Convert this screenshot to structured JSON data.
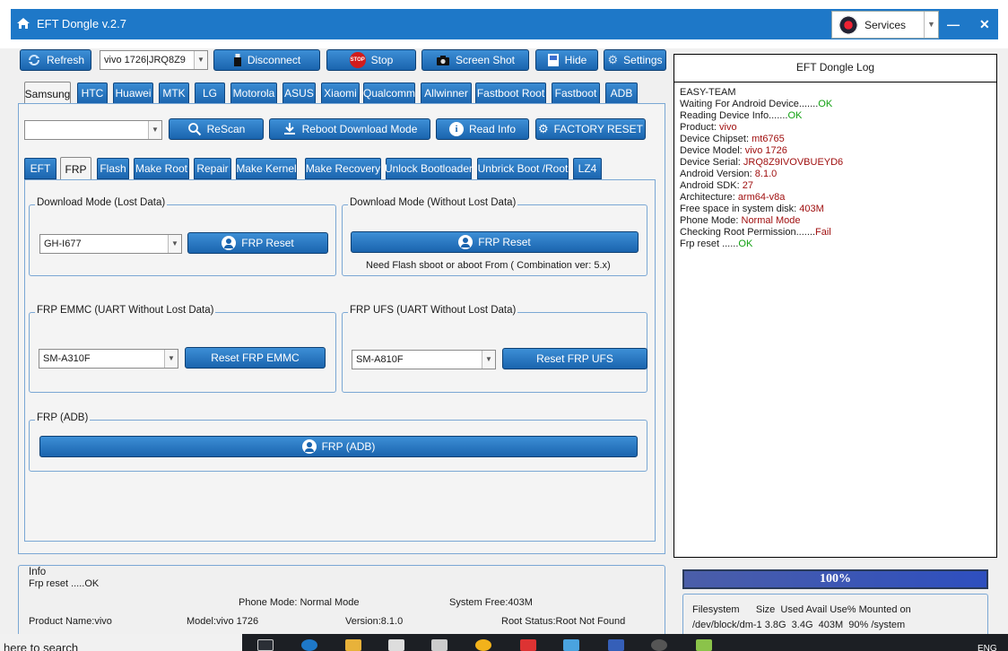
{
  "window": {
    "title": "EFT Dongle  v.2.7",
    "services_label": "Services",
    "min_glyph": "—",
    "close_glyph": "✕"
  },
  "toolbar": {
    "refresh": "Refresh",
    "device_combo": "vivo 1726|JRQ8Z9",
    "disconnect": "Disconnect",
    "stop": "Stop",
    "stop_badge": "STOP",
    "screenshot": "Screen Shot",
    "hide": "Hide",
    "settings": "Settings"
  },
  "brand_tabs": [
    "Samsung",
    "HTC",
    "Huawei",
    "MTK",
    "LG",
    "Motorola",
    "ASUS",
    "Xiaomi",
    "Qualcomm",
    "Allwinner",
    "Fastboot Root",
    "Fastboot",
    "ADB"
  ],
  "actions": {
    "rescan": "ReScan",
    "reboot_download": "Reboot  Download Mode",
    "read_info": "Read Info",
    "factory_reset": "FACTORY RESET"
  },
  "function_tabs": [
    "EFT",
    "FRP",
    "Flash",
    "Make Root",
    "Repair",
    "Make Kernel",
    "Make Recovery",
    "Unlock Bootloader",
    "Unbrick Boot /Root",
    "LZ4"
  ],
  "frp": {
    "download_lost": {
      "title": "Download Mode (Lost Data)",
      "model": "GH-I677",
      "button": "FRP Reset"
    },
    "download_nolost": {
      "title": "Download Mode (Without Lost Data)",
      "button": "FRP Reset",
      "note": "Need Flash sboot  or aboot From ( Combination ver: 5.x)"
    },
    "emmc": {
      "title": "FRP EMMC (UART Without Lost Data)",
      "model": "SM-A310F",
      "button": "Reset FRP EMMC"
    },
    "ufs": {
      "title": "FRP UFS (UART Without Lost Data)",
      "model": "SM-A810F",
      "button": "Reset FRP UFS"
    },
    "adb": {
      "title": "FRP (ADB)",
      "button": "FRP (ADB)"
    }
  },
  "log": {
    "title": "EFT Dongle Log",
    "lines": [
      {
        "label": "EASY-TEAM",
        "value": "",
        "cls": ""
      },
      {
        "label": "Waiting For Android Device.......",
        "value": "OK",
        "cls": "ok"
      },
      {
        "label": "Reading Device Info.......",
        "value": "OK",
        "cls": "ok"
      },
      {
        "label": "Product: ",
        "value": "vivo",
        "cls": "val"
      },
      {
        "label": "Device Chipset: ",
        "value": "mt6765",
        "cls": "val"
      },
      {
        "label": "Device Model: ",
        "value": "vivo 1726",
        "cls": "val"
      },
      {
        "label": "Device Serial: ",
        "value": "JRQ8Z9IVOVBUEYD6",
        "cls": "val"
      },
      {
        "label": "Android Version: ",
        "value": "8.1.0",
        "cls": "val"
      },
      {
        "label": "Android SDK: ",
        "value": "27",
        "cls": "val"
      },
      {
        "label": "Architecture: ",
        "value": "arm64-v8a",
        "cls": "val"
      },
      {
        "label": "Free space in system disk: ",
        "value": "403M",
        "cls": "val"
      },
      {
        "label": "Phone Mode: ",
        "value": "Normal Mode",
        "cls": "val"
      },
      {
        "label": "Checking Root Permission.......",
        "value": "Fail",
        "cls": "val"
      },
      {
        "label": "Frp reset ......",
        "value": "OK",
        "cls": "ok"
      }
    ]
  },
  "progress": {
    "percent": 100,
    "label": "100%"
  },
  "info": {
    "title": "Info",
    "last": "Frp reset .....OK",
    "phone_mode": "Phone Mode: Normal Mode",
    "system_free": "System Free:403M",
    "product": "Product Name:vivo",
    "model": "Model:vivo 1726",
    "version": "Version:8.1.0",
    "root": "Root Status:Root Not Found"
  },
  "fs": {
    "header": "Filesystem      Size  Used Avail Use% Mounted on",
    "row": "/dev/block/dm-1 3.8G  3.4G  403M  90% /system"
  },
  "taskbar": {
    "search": "here to search",
    "lang": "ENG"
  },
  "colors": {
    "accent": "#1e78c8",
    "button": "#1f6cb6",
    "ok": "#10a010",
    "value": "#a01010"
  }
}
